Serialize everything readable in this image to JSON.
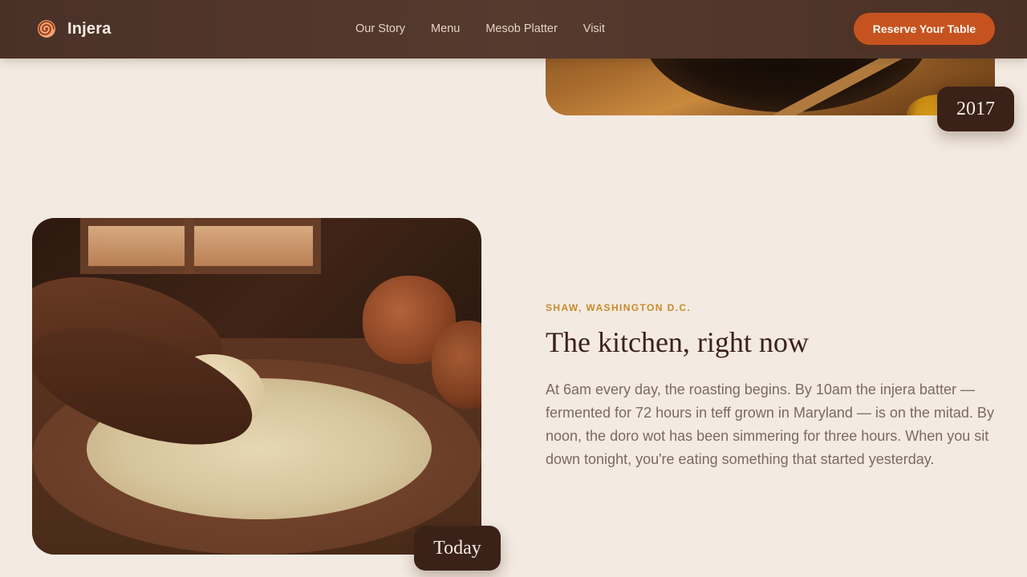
{
  "nav": {
    "brand": "Injera",
    "links": [
      "Our Story",
      "Menu",
      "Mesob Platter",
      "Visit"
    ],
    "cta": "Reserve Your Table"
  },
  "timeline": {
    "previous_badge": "2017",
    "current_badge": "Today"
  },
  "section": {
    "eyebrow": "SHAW, WASHINGTON D.C.",
    "title": "The kitchen, right now",
    "body": "At 6am every day, the roasting begins. By 10am the injera batter — fermented for 72 hours in teff grown in Maryland — is on the mitad. By noon, the doro wot has been simmering for three hours. When you sit down tonight, you're eating something that started yesterday."
  },
  "colors": {
    "background": "#f3eae1",
    "nav": "#4a3127",
    "accent": "#c6531f",
    "badge": "#3b2219",
    "eyebrow": "#c88a2a"
  },
  "icons": {
    "logo": "spiral-logo-icon"
  }
}
